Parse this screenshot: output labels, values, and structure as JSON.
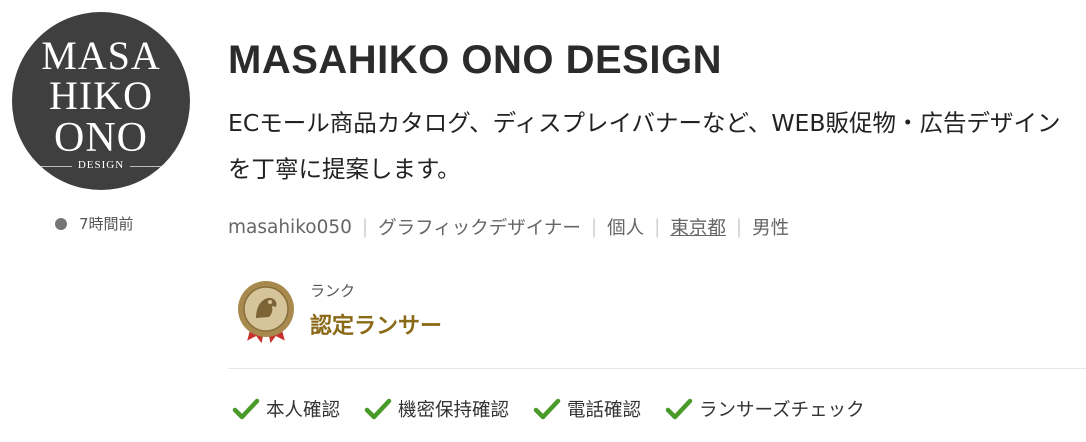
{
  "profile": {
    "avatar_text": [
      "MASA",
      "HIKO",
      "ONO",
      "DESIGN"
    ],
    "last_active": "7時間前",
    "name": "MASAHIKO ONO DESIGN",
    "catchphrase": "ECモール商品カタログ、ディスプレイバナーなど、WEB販促物・広告デザインを丁寧に提案します。",
    "username": "masahiko050",
    "occupation": "グラフィックデザイナー",
    "type": "個人",
    "location": "東京都",
    "gender": "男性"
  },
  "rank": {
    "label": "ランク",
    "name": "認定ランサー"
  },
  "verifications": [
    {
      "label": "本人確認"
    },
    {
      "label": "機密保持確認"
    },
    {
      "label": "電話確認"
    },
    {
      "label": "ランサーズチェック"
    }
  ],
  "colors": {
    "avatar_bg": "#3f3f3f",
    "rank_gold": "#8a6a17",
    "check_green": "#4a9a2a",
    "online_dot": "#757575"
  }
}
